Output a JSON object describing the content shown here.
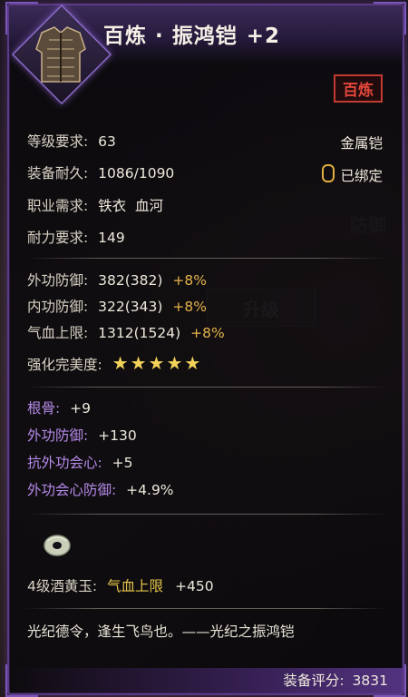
{
  "title": {
    "name": "百炼 · 振鸿铠",
    "level": "+2"
  },
  "quality": "百炼",
  "requirements": [
    {
      "label": "等级要求:",
      "value": "63"
    },
    {
      "label": "装备耐久:",
      "value": "1086/1090"
    },
    {
      "label": "职业需求:",
      "value": "铁衣  血河"
    },
    {
      "label": "耐力要求:",
      "value": "149"
    }
  ],
  "equip_type": "金属铠",
  "bind_status": "已绑定",
  "base_stats": [
    {
      "label": "外功防御:",
      "value": "382(382)",
      "bonus": "+8%"
    },
    {
      "label": "内功防御:",
      "value": "322(343)",
      "bonus": "+8%"
    },
    {
      "label": "气血上限:",
      "value": "1312(1524)",
      "bonus": "+8%"
    }
  ],
  "perfection": {
    "label": "强化完美度:",
    "stars": 5,
    "star_glyph": "★"
  },
  "extra_stats": [
    {
      "label": "根骨:",
      "value": "+9"
    },
    {
      "label": "外功防御:",
      "value": "+130"
    },
    {
      "label": "抗外功会心:",
      "value": "+5"
    },
    {
      "label": "外功会心防御:",
      "value": "+4.9%"
    }
  ],
  "gem": {
    "icon": "jade-ring-icon",
    "label": "4级酒黄玉:",
    "stat": "气血上限",
    "value": "+450"
  },
  "flavor_text": "光纪德令，逢生飞鸟也。——光纪之振鸿铠",
  "score": {
    "label": "装备评分:",
    "value": "3831"
  },
  "background": {
    "label_defense": "防御",
    "label_upgrade": "升级"
  },
  "colors": {
    "border": "#5a3a86",
    "bonus": "#e6b34a",
    "purple_stat": "#b48ae8",
    "quality": "#e0463a",
    "gem": "#e6c64a"
  }
}
